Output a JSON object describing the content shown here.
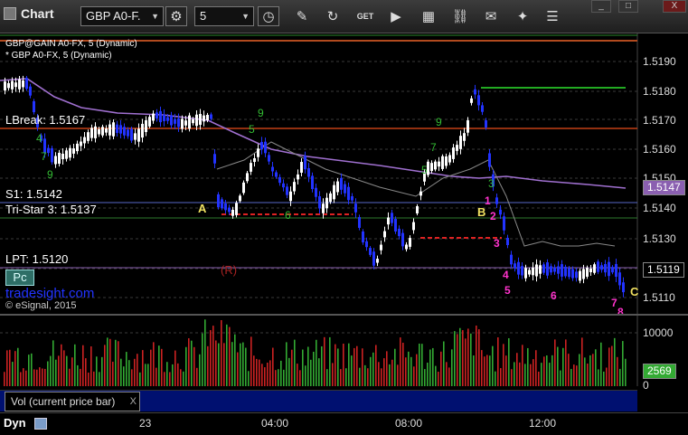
{
  "toolbar": {
    "title": "Chart",
    "symbol": "GBP A0-F.",
    "interval": "5",
    "icons": [
      "gear-icon",
      "clock-icon",
      "pencil-icon",
      "refresh-icon",
      "get-icon",
      "play-icon",
      "link-icon",
      "chat-icon",
      "twitter-icon",
      "menu-icon"
    ]
  },
  "window": {
    "minimize": "_",
    "restore": "□",
    "close": "X"
  },
  "legend": {
    "line1": "GBP@GAIN A0-FX, 5 (Dynamic)",
    "line2": "* GBP A0-FX, 5 (Dynamic)"
  },
  "levels": {
    "lbreak": "LBreak: 1.5167",
    "s1": "S1: 1.5142",
    "tristar": "Tri-Star 3: 1.5137",
    "lpt": "LPT: 1.5120",
    "r_marker": "(R)",
    "pc": "Pc",
    "watermark": "tradesight.com",
    "copyright": "© eSignal, 2015"
  },
  "price_axis": {
    "labels": [
      "1.5190",
      "1.5180",
      "1.5170",
      "1.5160",
      "1.5150",
      "1.5140",
      "1.5130",
      "1.5110"
    ],
    "badge_ma": "1.5147",
    "badge_last": "1.5119",
    "ma_color": "#8a5fb0"
  },
  "markers": {
    "a": "A",
    "b": "B",
    "c": "C",
    "counts": [
      "1",
      "2",
      "3",
      "4",
      "5",
      "6",
      "7",
      "8"
    ],
    "count_color": "#ff33cc"
  },
  "volume": {
    "axis_top": "10000",
    "badge": "2569",
    "axis_zero": "0",
    "label": "Vol (current price bar)",
    "close": "X"
  },
  "time_axis": {
    "dyn": "Dyn",
    "labels": [
      "23",
      "04:00",
      "08:00",
      "12:00"
    ]
  },
  "colors": {
    "up_candle": "#ffffff",
    "down_candle": "#2233ff",
    "volume_up": "#33aa33",
    "volume_down": "#cc2222"
  }
}
